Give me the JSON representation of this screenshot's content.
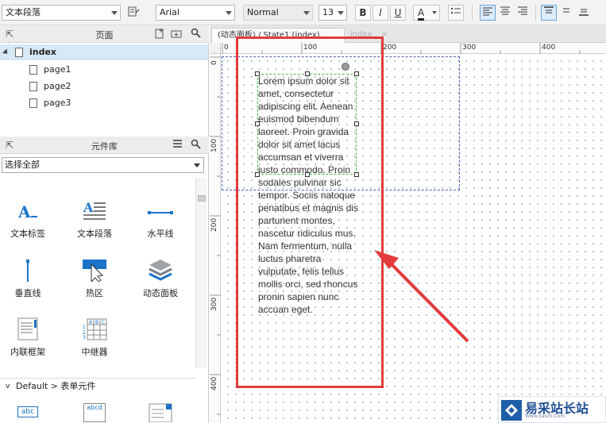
{
  "toolbar": {
    "widget_style": "文本段落",
    "font_family": "Arial",
    "font_style": "Normal",
    "font_size": "13",
    "bold": "B",
    "italic": "I",
    "underline": "U",
    "font_color": "A"
  },
  "pages_panel": {
    "title": "页面",
    "items": [
      {
        "label": "index"
      },
      {
        "label": "page1"
      },
      {
        "label": "page2"
      },
      {
        "label": "page3"
      }
    ]
  },
  "library_panel": {
    "title": "元件库",
    "filter_value": "选择全部",
    "widgets": [
      {
        "label": "文本标签",
        "icon": "text-label-icon"
      },
      {
        "label": "文本段落",
        "icon": "text-paragraph-icon"
      },
      {
        "label": "水平线",
        "icon": "horizontal-line-icon"
      },
      {
        "label": "垂直线",
        "icon": "vertical-line-icon"
      },
      {
        "label": "热区",
        "icon": "hotspot-icon"
      },
      {
        "label": "动态面板",
        "icon": "dynamic-panel-icon"
      },
      {
        "label": "内联框架",
        "icon": "inline-frame-icon"
      },
      {
        "label": "中继器",
        "icon": "repeater-icon"
      }
    ],
    "group_label": "Default > 表单元件",
    "form_widgets": [
      {
        "label": "abc",
        "icon": "text-field-icon"
      },
      {
        "label": "abcd",
        "icon": "text-area-icon"
      }
    ]
  },
  "canvas": {
    "tabs": [
      {
        "label": "(动态面板) / State1 (index)"
      },
      {
        "label": "index"
      }
    ],
    "ruler_h": [
      "0",
      "100",
      "200",
      "300",
      "400"
    ],
    "ruler_v": [
      "0",
      "100",
      "200",
      "300",
      "400"
    ],
    "text": "Lorem ipsum dolor sit amet, consectetur adipiscing elit. Aenean euismod bibendum laoreet. Proin gravida dolor sit amet lacus accumsan et viverra justo commodo. Proin sodales pulvinar sic tempor. Sociis natoque penatibus et magnis dis parturient montes, nascetur ridiculus mus. Nam fermentum, nulla luctus pharetra vulputate, felis tellus mollis orci, sed rhoncus pronin sapien nunc accuan eget."
  },
  "watermark": {
    "title": "易采站长站",
    "subtitle": "Www.Easck.Com"
  }
}
